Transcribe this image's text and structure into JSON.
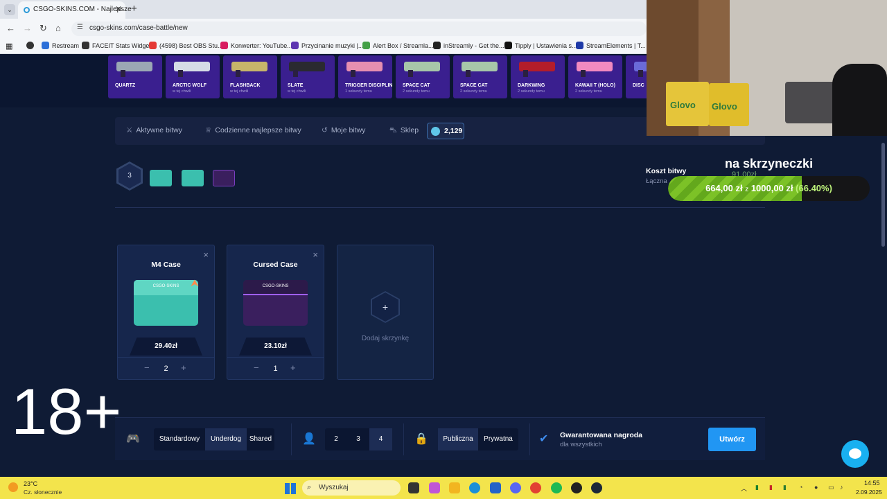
{
  "browser": {
    "tab_title": "CSGO-SKINS.COM - Najlepsze",
    "url": "csgo-skins.com/case-battle/new",
    "bookmarks": [
      {
        "label": "Restream",
        "color": "#2b6fd8"
      },
      {
        "label": "FACEIT Stats Widget",
        "color": "#333333"
      },
      {
        "label": "(4598) Best OBS Stu...",
        "color": "#e53935"
      },
      {
        "label": "Konwerter: YouTube...",
        "color": "#d81b60"
      },
      {
        "label": "Przycinanie muzyki |...",
        "color": "#5e35b1"
      },
      {
        "label": "Alert Box / Streamla...",
        "color": "#43a047"
      },
      {
        "label": "inStreamly - Get the...",
        "color": "#222222"
      },
      {
        "label": "Tipply | Ustawienia s...",
        "color": "#111111"
      },
      {
        "label": "StreamElements | T...",
        "color": "#1e3aa8"
      }
    ]
  },
  "live_feed": [
    {
      "name": "QUARTZ",
      "time": "",
      "color": "#9ba8b4"
    },
    {
      "name": "ARCTIC WOLF",
      "time": "w tej chwili",
      "color": "#d6dde6"
    },
    {
      "name": "FLASHBACK",
      "time": "w tej chwili",
      "color": "#c7b56a"
    },
    {
      "name": "SLATE",
      "time": "w tej chwili",
      "color": "#2a2a30"
    },
    {
      "name": "TRIGGER DISCIPLINE",
      "time": "1 sekundy temu",
      "color": "#e68fb0"
    },
    {
      "name": "SPACE CAT",
      "time": "2 sekundy temu",
      "color": "#a7c7a9"
    },
    {
      "name": "SPACE CAT",
      "time": "2 sekundy temu",
      "color": "#a7c7a9"
    },
    {
      "name": "DARKWING",
      "time": "2 sekundy temu",
      "color": "#b31d2a"
    },
    {
      "name": "KAWAII T (HOLO)",
      "time": "2 sekundy temu",
      "color": "#f28ac0"
    },
    {
      "name": "DISC",
      "time": "",
      "color": "#6a6ad8"
    }
  ],
  "battle_nav": {
    "items": [
      "Aktywne bitwy",
      "Codzienne najlepsze bitwy",
      "Moje bitwy",
      "Sklep"
    ],
    "coins": "2,129"
  },
  "selection": {
    "case_count": "3",
    "cost_label": "Koszt bitwy",
    "cost_sub": "Łączna"
  },
  "goal": {
    "title": "na skrzyneczki",
    "ghost": "91,00zł",
    "current": "664,00 zł",
    "sep": "z",
    "target": "1000,00 zł",
    "percent": "(66.40%)",
    "fraction": 0.664
  },
  "age_badge": "18+",
  "cases": [
    {
      "name": "M4 Case",
      "price": "29.40zł",
      "qty": "2",
      "color": "#3bbfae",
      "lid": "#5fd6c3",
      "logo": "CSGO-SKINS",
      "remove": "×",
      "minus": "−",
      "plus": "+"
    },
    {
      "name": "Cursed Case",
      "price": "23.10zł",
      "qty": "1",
      "color": "#3a1f5e",
      "lid": "#7a3fc0",
      "logo": "CSGO-SKINS",
      "remove": "×",
      "minus": "−",
      "plus": "+"
    }
  ],
  "add_case": {
    "label": "Dodaj skrzynkę",
    "plus": "+"
  },
  "options": {
    "modes": [
      "Standardowy",
      "Underdog",
      "Shared"
    ],
    "active_mode": "Underdog",
    "players": [
      "2",
      "3",
      "4"
    ],
    "active_players": "4",
    "visibility": [
      "Publiczna",
      "Prywatna"
    ],
    "active_visibility": "Publiczna",
    "guarantee_title": "Gwarantowana nagroda",
    "guarantee_sub": "dla wszystkich",
    "create_label": "Utwórz"
  },
  "webcam": {
    "bag_text": "Glovo"
  },
  "taskbar": {
    "temp": "23°C",
    "weather": "Cz. słonecznie",
    "search_placeholder": "Wyszukaj",
    "time": "14:55",
    "date": "2.09.2025"
  }
}
